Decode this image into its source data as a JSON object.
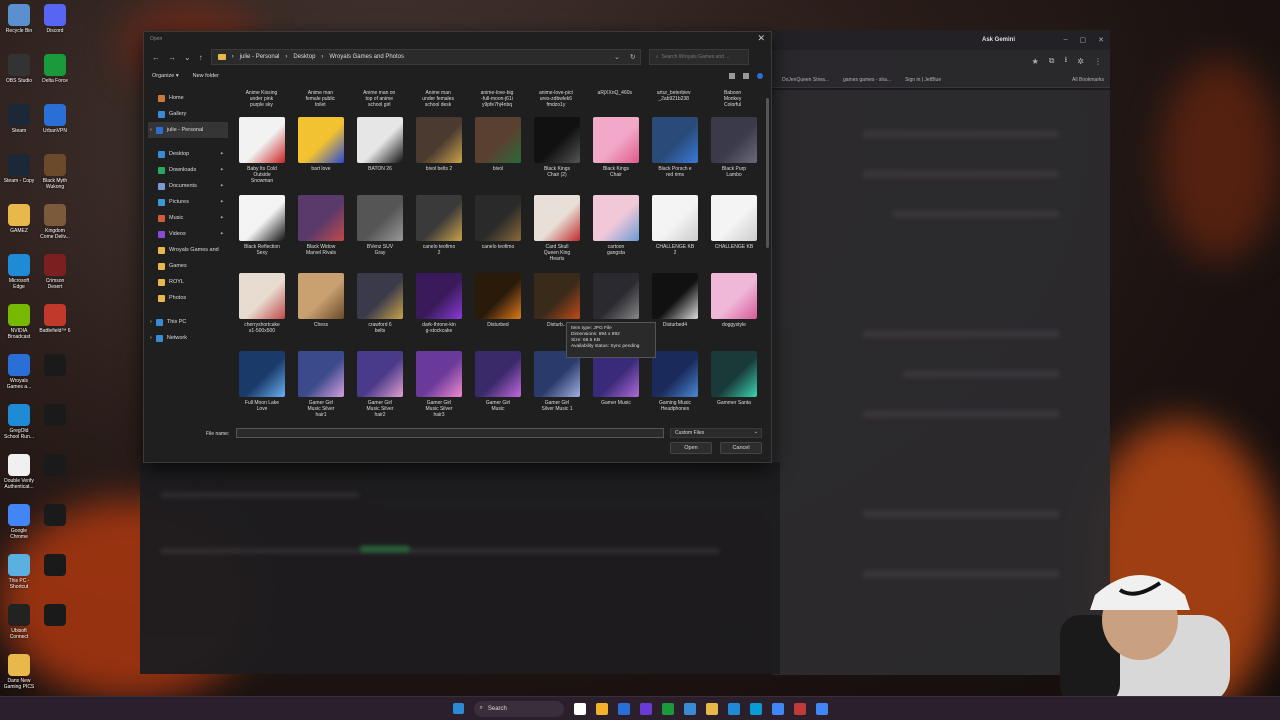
{
  "desktop_icons": [
    {
      "label": "Recycle Bin",
      "color": "#5a8fd0"
    },
    {
      "label": "Discord",
      "color": "#5865f2"
    },
    {
      "label": "OBS Studio",
      "color": "#333333"
    },
    {
      "label": "Delta Force",
      "color": "#1a9a3a"
    },
    {
      "label": "Steam",
      "color": "#1b2838"
    },
    {
      "label": "UrbanVPN",
      "color": "#2a6fd6"
    },
    {
      "label": "Steam - Copy",
      "color": "#1b2838"
    },
    {
      "label": "Black Myth\nWukong",
      "color": "#6a4a2a"
    },
    {
      "label": "GAMEZ",
      "color": "#e8b84a"
    },
    {
      "label": "Kingdom\nCome Deliv...",
      "color": "#7a5a3a"
    },
    {
      "label": "Microsoft\nEdge",
      "color": "#1f8ad6"
    },
    {
      "label": "Crimson\nDesert",
      "color": "#7a2020"
    },
    {
      "label": "NVIDIA\nBroadcast",
      "color": "#76b900"
    },
    {
      "label": "Battlefield™ 6",
      "color": "#c0392b"
    },
    {
      "label": "Wroyals\nGames a...",
      "color": "#2a6fd6"
    },
    {
      "label": "",
      "color": "#1a1a1a"
    },
    {
      "label": "GregOld\nSchool Run...",
      "color": "#1f8ad6"
    },
    {
      "label": "",
      "color": "#1a1a1a"
    },
    {
      "label": "Double Verify\nAuthenticat...",
      "color": "#f0f0f0"
    },
    {
      "label": "",
      "color": "#1a1a1a"
    },
    {
      "label": "Google\nChrome",
      "color": "#4285f4"
    },
    {
      "label": "",
      "color": "#1a1a1a"
    },
    {
      "label": "This PC -\nShortcut",
      "color": "#5ab0e0"
    },
    {
      "label": "",
      "color": "#1a1a1a"
    },
    {
      "label": "Ubisoft\nConnect",
      "color": "#222222"
    },
    {
      "label": "",
      "color": "#1a1a1a"
    },
    {
      "label": "Dans New\nGaming PICS",
      "color": "#e8b84a"
    }
  ],
  "browser": {
    "gemini_label": "Ask Gemini",
    "bookmarks": [
      "DoJenQueen Strea...",
      "games games - sha...",
      "Sign in | JetBlue"
    ],
    "all_bookmarks": "All Bookmarks"
  },
  "dialog": {
    "title": "Open",
    "breadcrumb": [
      "julie - Personal",
      "Desktop",
      "Wroyals Games and Photos"
    ],
    "search_placeholder": "Search Wroyals Games and ...",
    "organize_label": "Organize ▾",
    "new_folder_label": "New folder",
    "nav_items": [
      {
        "label": "Home",
        "color": "#c97a3a",
        "pinned": false,
        "selected": false,
        "expand": false
      },
      {
        "label": "Gallery",
        "color": "#3a8ad6",
        "pinned": false,
        "selected": false,
        "expand": false
      },
      {
        "label": "julie - Personal",
        "color": "#2a6fd6",
        "pinned": false,
        "selected": true,
        "expand": true
      },
      {
        "label": "",
        "color": "",
        "pinned": false,
        "selected": false,
        "expand": false
      },
      {
        "label": "Desktop",
        "color": "#3a8ad6",
        "pinned": true,
        "selected": false,
        "expand": false
      },
      {
        "label": "Downloads",
        "color": "#2aa860",
        "pinned": true,
        "selected": false,
        "expand": false
      },
      {
        "label": "Documents",
        "color": "#7a9ad6",
        "pinned": true,
        "selected": false,
        "expand": false
      },
      {
        "label": "Pictures",
        "color": "#3a9ad6",
        "pinned": true,
        "selected": false,
        "expand": false
      },
      {
        "label": "Music",
        "color": "#d65a3a",
        "pinned": true,
        "selected": false,
        "expand": false
      },
      {
        "label": "Videos",
        "color": "#8a4ad6",
        "pinned": true,
        "selected": false,
        "expand": false
      },
      {
        "label": "Wroyals Games and",
        "color": "#e8b84a",
        "pinned": false,
        "selected": false,
        "expand": false
      },
      {
        "label": "Games",
        "color": "#e8b84a",
        "pinned": false,
        "selected": false,
        "expand": false
      },
      {
        "label": "ROYL",
        "color": "#e8b84a",
        "pinned": false,
        "selected": false,
        "expand": false
      },
      {
        "label": "Photos",
        "color": "#e8b84a",
        "pinned": false,
        "selected": false,
        "expand": false
      },
      {
        "label": "",
        "color": "",
        "pinned": false,
        "selected": false,
        "expand": false
      },
      {
        "label": "This PC",
        "color": "#3a8ad6",
        "pinned": false,
        "selected": false,
        "expand": true
      },
      {
        "label": "Network",
        "color": "#3a8ad6",
        "pinned": false,
        "selected": false,
        "expand": true
      }
    ],
    "top_row_captions": [
      "Anime Kissing\nunder pink\npurple sky",
      "Anime man\nfemale public\ntoilet",
      "Anime man on\ntop of anime\nschool girl",
      "Anime man\nunder females\nschool desk",
      "anime-love-big\n-full-moon-j61i\ny9pfe7hj4nbq",
      "anime-love-pict\nures-zdbwlek6\nfmdzo1y",
      "aRjXXnQ_460s",
      "artur_beterbiev\n_2ab921b238",
      "Baboon\nMonkey\nColorful"
    ],
    "files": [
      {
        "name": "Baby Its Cold\nOutside\nSnowman",
        "color": "#f2f2f2",
        "accent": "#cc2222"
      },
      {
        "name": "bart love",
        "color": "#f2c230",
        "accent": "#2a4ad6"
      },
      {
        "name": "BATON 26",
        "color": "#e6e6e6",
        "accent": "#111111"
      },
      {
        "name": "bivol belts 2",
        "color": "#4a3a30",
        "accent": "#c9a24a"
      },
      {
        "name": "bivol",
        "color": "#5a4030",
        "accent": "#2a6a3a"
      },
      {
        "name": "Black Kings\nChair (2)",
        "color": "#111111",
        "accent": "#555555"
      },
      {
        "name": "Black Kings\nChair",
        "color": "#f2a8c8",
        "accent": "#e05a8a"
      },
      {
        "name": "Black Porsch e\nred rims",
        "color": "#2a4a7a",
        "accent": "#3a7ad6"
      },
      {
        "name": "Black Purp\nLambo",
        "color": "#3a3a4a",
        "accent": "#6a6a7a"
      },
      {
        "name": "Black Reflection\nSexy",
        "color": "#f4f4f4",
        "accent": "#111111"
      },
      {
        "name": "Black Widow\nMarvel Rivals",
        "color": "#5a3a6a",
        "accent": "#c04a4a"
      },
      {
        "name": "BVenz SUV\nGray",
        "color": "#555555",
        "accent": "#999999"
      },
      {
        "name": "canelo teofimo\n2",
        "color": "#3a3a3a",
        "accent": "#c9a24a"
      },
      {
        "name": "canelo teofimo",
        "color": "#2a2a2a",
        "accent": "#8a6a3a"
      },
      {
        "name": "Card Skull\nQueen King\nHearts",
        "color": "#e8e0d8",
        "accent": "#c02a2a"
      },
      {
        "name": "cartoon\ngangsta",
        "color": "#f0c8d8",
        "accent": "#6a9ad6"
      },
      {
        "name": "CHALLENGE KB\n2",
        "color": "#f4f4f4",
        "accent": "#cccccc"
      },
      {
        "name": "CHALLENGE KB",
        "color": "#f4f4f4",
        "accent": "#cccccc"
      },
      {
        "name": "cherryshortcake\ns1-500x500",
        "color": "#e8dcd0",
        "accent": "#c04a4a"
      },
      {
        "name": "Chess",
        "color": "#c9a070",
        "accent": "#6a4a2a"
      },
      {
        "name": "crawford 6\nbelts",
        "color": "#3a3a4a",
        "accent": "#c9a24a"
      },
      {
        "name": "dark-throne-kin\ng-stockcake",
        "color": "#3a1a5a",
        "accent": "#8a3ad6"
      },
      {
        "name": "Disturbed",
        "color": "#2a1a0a",
        "accent": "#e07a1a"
      },
      {
        "name": "Disturb...",
        "color": "#3a2a1a",
        "accent": "#c04a1a"
      },
      {
        "name": "",
        "color": "#2a2a30",
        "accent": "#888888"
      },
      {
        "name": "Disturbed4",
        "color": "#111111",
        "accent": "#dddddd"
      },
      {
        "name": "doggystyle",
        "color": "#f0b8d8",
        "accent": "#d65a9a"
      },
      {
        "name": "Full Moon Lake\nLove",
        "color": "#1a3a6a",
        "accent": "#6ab0f0"
      },
      {
        "name": "Gamer Girl\nMusic Silver\nhair1",
        "color": "#3a4a8a",
        "accent": "#d6a0e0"
      },
      {
        "name": "Gamer Girl\nMusic Silver\nhair2",
        "color": "#4a3a8a",
        "accent": "#e0a0d0"
      },
      {
        "name": "Gamer Girl\nMusic Silver\nhair3",
        "color": "#6a3a9a",
        "accent": "#f08ad0"
      },
      {
        "name": "Gamer Girl\nMusic",
        "color": "#3a2a6a",
        "accent": "#c06ae0"
      },
      {
        "name": "Gamer Girl\nSilver Music 1",
        "color": "#2a3a6a",
        "accent": "#a0b0e0"
      },
      {
        "name": "Gamer Music",
        "color": "#3a2a7a",
        "accent": "#b06ad6"
      },
      {
        "name": "Gaming Music\nHeadphones",
        "color": "#1a2a5a",
        "accent": "#4a8ad6"
      },
      {
        "name": "Gammer Santa",
        "color": "#1a3a3a",
        "accent": "#3ad6b0"
      }
    ],
    "tooltip": {
      "type": "Item type: JPG File",
      "dimensions": "Dimensions: 894 x 892",
      "size": "Size: 68.5 KB",
      "availability": "Availability status: Sync pending"
    },
    "file_name_label": "File name:",
    "file_name_value": "",
    "file_type": "Custom Files",
    "open_label": "Open",
    "cancel_label": "Cancel"
  },
  "taskbar": {
    "search_label": "Search",
    "icons": [
      "#ffffff",
      "#f2b22a",
      "#2a6fd6",
      "#6a3ad6",
      "#1a9a3a",
      "#3a8ad6",
      "#e8b84a",
      "#1f8ad6",
      "#0a9ad6",
      "#4285f4",
      "#c03a3a",
      "#4285f4"
    ]
  }
}
